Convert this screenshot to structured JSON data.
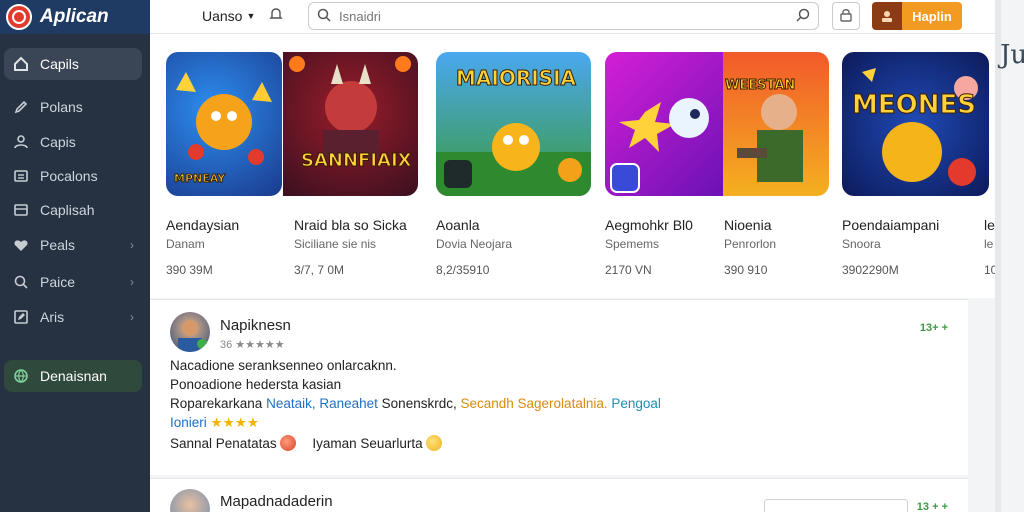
{
  "brand": {
    "title": "Aplican"
  },
  "sidebar": {
    "items": [
      {
        "label": "Capils",
        "icon": "home-icon"
      },
      {
        "label": "Polans",
        "icon": "pen-icon"
      },
      {
        "label": "Capis",
        "icon": "user-icon"
      },
      {
        "label": "Pocalons",
        "icon": "list-icon"
      },
      {
        "label": "Caplisah",
        "icon": "archive-icon"
      },
      {
        "label": "Peals",
        "icon": "heart-icon"
      },
      {
        "label": "Paice",
        "icon": "tag-icon"
      },
      {
        "label": "Aris",
        "icon": "edit-icon"
      }
    ],
    "bottom": {
      "label": "Denaisnan",
      "icon": "globe-icon"
    }
  },
  "topbar": {
    "language": "Uanso",
    "search_placeholder": "Isnaidri",
    "cta_label": "Haplin"
  },
  "edge_text": "Ju",
  "apps": [
    {
      "name": "Aendaysian",
      "sub": "Danam",
      "size": "390 39M",
      "art": "MPNEAY"
    },
    {
      "name": "Nraid bla so Sicka",
      "sub": "Siciliane sie nis",
      "size": "3/7, 7 0M",
      "art": "SANNFIAIX"
    },
    {
      "name": "Aoanla",
      "sub": "Dovia Neojara",
      "size": "8,2/35910",
      "art": "MAIORISIA"
    },
    {
      "name": "Aegmohkr Bl0",
      "sub": "Spemems",
      "size": "2170 VN",
      "art": ""
    },
    {
      "name": "Nioenia",
      "sub": "Penrorlon",
      "size": "390 910",
      "art": "WEESTAN"
    },
    {
      "name": "Poendaiampani",
      "sub": "Snoora",
      "size": "3902290M",
      "art": "MEONES"
    },
    {
      "name": "le",
      "sub": "le",
      "size": "10",
      "art": ""
    }
  ],
  "reviews": [
    {
      "name": "Napiknesn",
      "meta": "36 ★★★★★",
      "time": "13+ +",
      "line1": "Nacadione seranksenneo onlarcaknn.",
      "line2": "Ponoadione hedersta kasian",
      "line3_a": "Roparekarkana",
      "line3_b": "Neataik, Raneahet",
      "line3_c": "Sonenskrdc,",
      "line3_d": "Secandh Sagerolatalnia.",
      "line3_e": "Pengoal",
      "line4_a": "Ionieri",
      "line4_stars": "★★★★",
      "line5_a": "Sannal Penatatas",
      "line5_b": "Iyaman Seuarlurta"
    },
    {
      "name": "Mapadnadaderin",
      "time": "13 + +"
    }
  ]
}
